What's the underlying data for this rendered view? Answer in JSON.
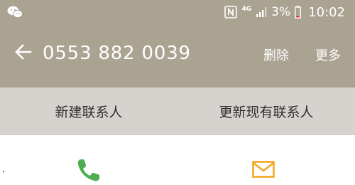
{
  "status_bar": {
    "network": "4G",
    "battery_percent": "3%",
    "time": "10:02"
  },
  "app_bar": {
    "phone_number": "0553 882 0039",
    "delete_label": "删除",
    "more_label": "更多"
  },
  "actions": {
    "new_contact": "新建联系人",
    "update_contact": "更新现有联系人"
  },
  "colors": {
    "header_bg": "#aaa392",
    "subbar_bg": "#d6d3cf",
    "call_green": "#4caf50",
    "message_orange": "#f5a623"
  },
  "icons": {
    "status_left": "wechat-icon",
    "status_right": [
      "nfc-icon",
      "signal-icon",
      "battery-icon"
    ],
    "back": "arrow-left-icon",
    "call": "phone-icon",
    "message": "mail-icon"
  }
}
